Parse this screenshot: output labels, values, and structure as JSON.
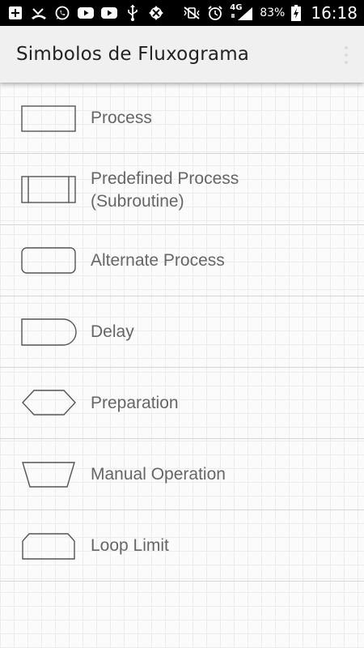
{
  "status_bar": {
    "network_type": "4G",
    "battery_percent": "83%",
    "time": "16:18",
    "icons": [
      "add-box-icon",
      "missed-call-icon",
      "whatsapp-icon",
      "youtube-icon",
      "youtube-icon",
      "usb-icon",
      "settings-alert-icon",
      "vibrate-icon",
      "alarm-icon",
      "signal-icon",
      "battery-charging-icon"
    ]
  },
  "app_bar": {
    "title": "Simbolos de Fluxograma",
    "menu_icon": "overflow-menu-icon"
  },
  "symbols": [
    {
      "label": "Process",
      "shape": "rectangle"
    },
    {
      "label": "Predefined Process\n(Subroutine)",
      "shape": "predefined-process"
    },
    {
      "label": "Alternate Process",
      "shape": "rounded-rectangle"
    },
    {
      "label": "Delay",
      "shape": "delay"
    },
    {
      "label": "Preparation",
      "shape": "hexagon"
    },
    {
      "label": "Manual Operation",
      "shape": "trapezoid"
    },
    {
      "label": "Loop Limit",
      "shape": "loop-limit"
    }
  ],
  "colors": {
    "status_bar": "#000000",
    "app_bar": "#f0f0f0",
    "background": "#fbfbfb",
    "grid": "#ececec",
    "label": "#666666",
    "shape_stroke": "#555555"
  }
}
